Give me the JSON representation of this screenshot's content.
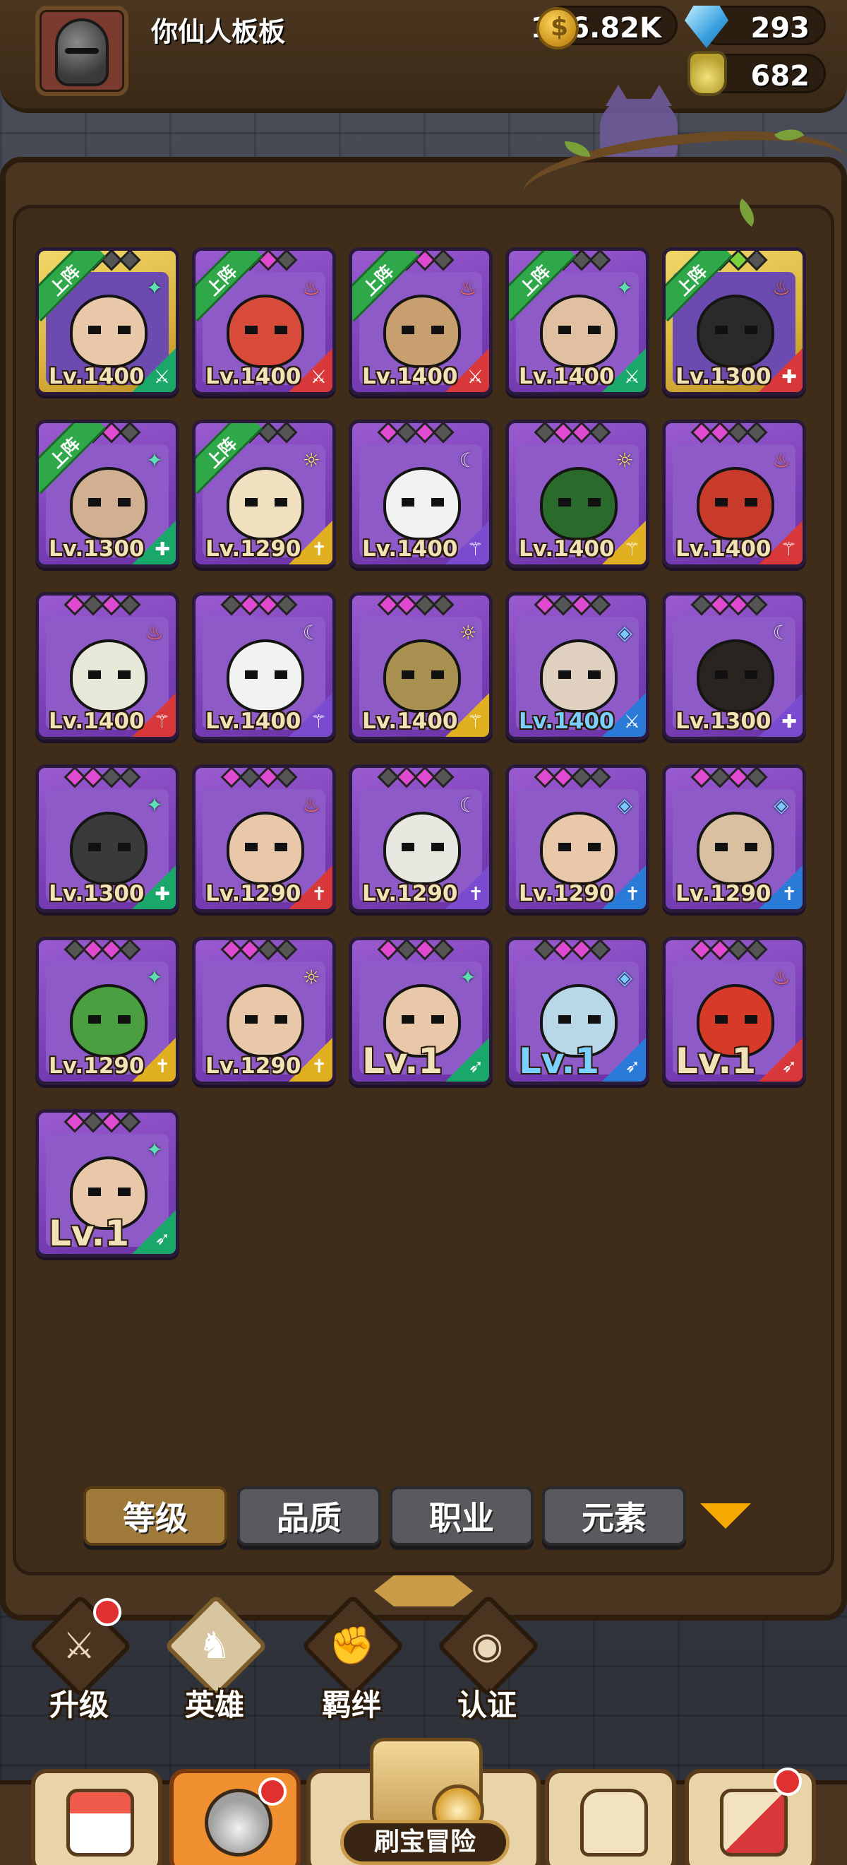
{
  "header": {
    "player_name": "你仙人板板",
    "gold": "136.82K",
    "gems": "293",
    "potions": "682"
  },
  "heroes": [
    {
      "level": "Lv.1400",
      "deployed": "上阵",
      "element": "wind",
      "class": "warrior",
      "rarity": "gold"
    },
    {
      "level": "Lv.1400",
      "deployed": "上阵",
      "element": "fire",
      "class": "warrior",
      "rarity": "epic"
    },
    {
      "level": "Lv.1400",
      "deployed": "上阵",
      "element": "fire",
      "class": "warrior",
      "rarity": "epic"
    },
    {
      "level": "Lv.1400",
      "deployed": "上阵",
      "element": "wind",
      "class": "warrior",
      "rarity": "epic"
    },
    {
      "level": "Lv.1300",
      "deployed": "上阵",
      "element": "fire",
      "class": "tank",
      "rarity": "gold"
    },
    {
      "level": "Lv.1300",
      "deployed": "上阵",
      "element": "wind",
      "class": "tank",
      "rarity": "epic"
    },
    {
      "level": "Lv.1290",
      "deployed": "上阵",
      "element": "light",
      "class": "priest",
      "rarity": "epic"
    },
    {
      "level": "Lv.1400",
      "element": "dark",
      "class": "mage",
      "rarity": "epic"
    },
    {
      "level": "Lv.1400",
      "element": "light",
      "class": "mage",
      "rarity": "epic"
    },
    {
      "level": "Lv.1400",
      "element": "fire",
      "class": "mage",
      "rarity": "epic"
    },
    {
      "level": "Lv.1400",
      "element": "fire",
      "class": "mage",
      "rarity": "epic"
    },
    {
      "level": "Lv.1400",
      "element": "dark",
      "class": "mage",
      "rarity": "epic"
    },
    {
      "level": "Lv.1400",
      "element": "light",
      "class": "mage",
      "rarity": "epic"
    },
    {
      "level": "Lv.1400",
      "element": "water",
      "class": "warrior",
      "rarity": "epic"
    },
    {
      "level": "Lv.1300",
      "element": "dark",
      "class": "tank",
      "rarity": "epic"
    },
    {
      "level": "Lv.1300",
      "element": "wind",
      "class": "tank",
      "rarity": "epic"
    },
    {
      "level": "Lv.1290",
      "element": "fire",
      "class": "priest",
      "rarity": "epic"
    },
    {
      "level": "Lv.1290",
      "element": "dark",
      "class": "priest",
      "rarity": "epic"
    },
    {
      "level": "Lv.1290",
      "element": "water",
      "class": "priest",
      "rarity": "epic"
    },
    {
      "level": "Lv.1290",
      "element": "water",
      "class": "priest",
      "rarity": "epic"
    },
    {
      "level": "Lv.1290",
      "element": "wind",
      "class": "priest",
      "rarity": "epic"
    },
    {
      "level": "Lv.1290",
      "element": "light",
      "class": "priest",
      "rarity": "epic"
    },
    {
      "level": "Lv.1",
      "element": "wind",
      "class": "archer",
      "rarity": "epic"
    },
    {
      "level": "Lv.1",
      "element": "water",
      "class": "archer",
      "rarity": "epic"
    },
    {
      "level": "Lv.1",
      "element": "fire",
      "class": "archer",
      "rarity": "epic"
    },
    {
      "level": "Lv.1",
      "element": "wind",
      "class": "archer",
      "rarity": "epic"
    }
  ],
  "sort_tabs": {
    "level": "等级",
    "quality": "品质",
    "class": "职业",
    "element": "元素"
  },
  "sub_nav": {
    "upgrade": "升级",
    "heroes": "英雄",
    "bond": "羁绊",
    "certify": "认证"
  },
  "bottom_nav": {
    "adventure": "刷宝冒险"
  },
  "colors": {
    "panel": "#4a3620",
    "card_epic": "#8d5ac8",
    "card_gold": "#d9b23a",
    "deploy_ribbon": "#2fa84a",
    "active_tab": "#a07a3a",
    "dropdown_arrow": "#f5a800"
  }
}
